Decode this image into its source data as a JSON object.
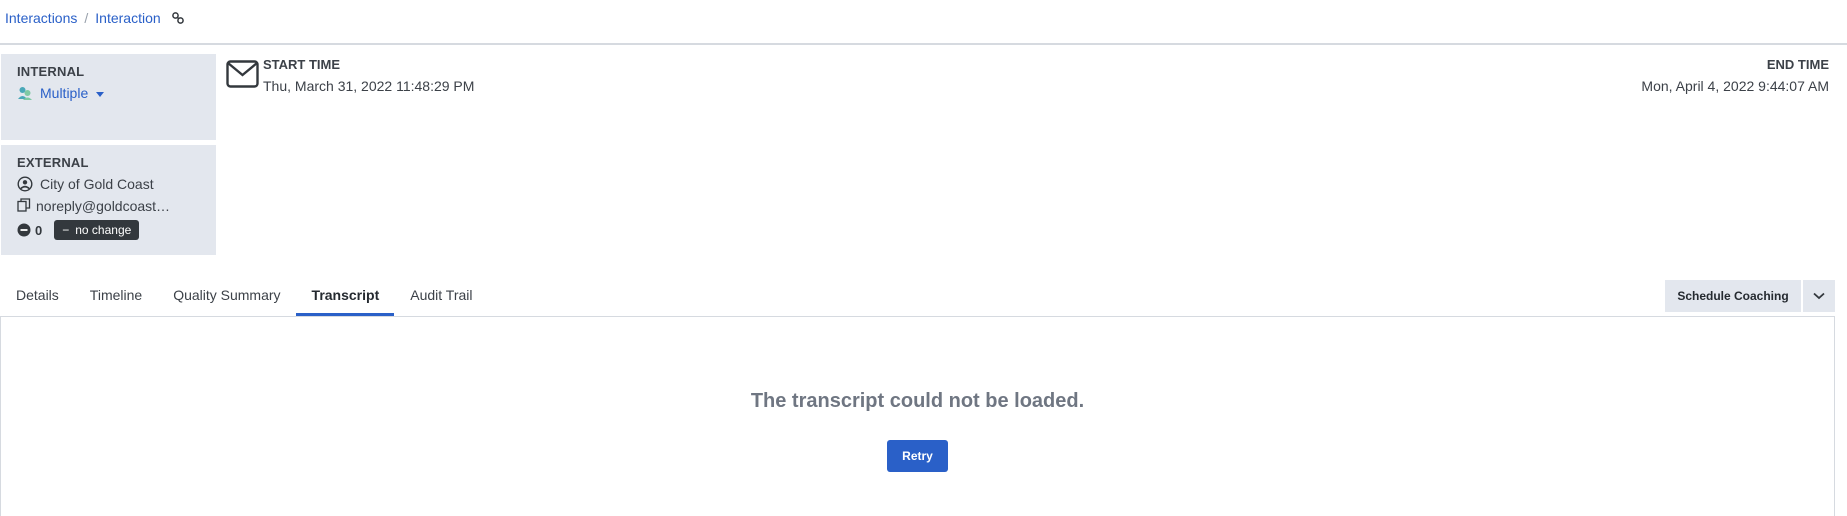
{
  "breadcrumb": {
    "items": [
      "Interactions",
      "Interaction"
    ],
    "separator": "/",
    "link_icon": "link-icon"
  },
  "internal": {
    "title": "INTERNAL",
    "participants_label": "Multiple",
    "icon": "users-group-icon"
  },
  "external": {
    "title": "EXTERNAL",
    "name": "City of Gold Coast",
    "email": "noreply@goldcoast…",
    "sentiment_count": "0",
    "sentiment_badge": "no change",
    "icons": [
      "person-circle-icon",
      "copy-icon",
      "minus-circle-icon"
    ]
  },
  "interaction": {
    "type_icon": "envelope-icon",
    "start_label": "START TIME",
    "start_value": "Thu, March 31, 2022 11:48:29 PM",
    "end_label": "END TIME",
    "end_value": "Mon, April 4, 2022 9:44:07 AM"
  },
  "tabs": [
    {
      "label": "Details",
      "active": false
    },
    {
      "label": "Timeline",
      "active": false
    },
    {
      "label": "Quality Summary",
      "active": false
    },
    {
      "label": "Transcript",
      "active": true
    },
    {
      "label": "Audit Trail",
      "active": false
    }
  ],
  "actions": {
    "schedule_coaching": "Schedule Coaching",
    "dropdown_icon": "chevron-down-icon"
  },
  "transcript": {
    "error_message": "The transcript could not be loaded.",
    "retry_label": "Retry"
  },
  "colors": {
    "accent": "#2a60c8",
    "panel_bg": "#e3e7ee",
    "badge_bg": "#33383d",
    "muted_text": "#6f7682"
  }
}
